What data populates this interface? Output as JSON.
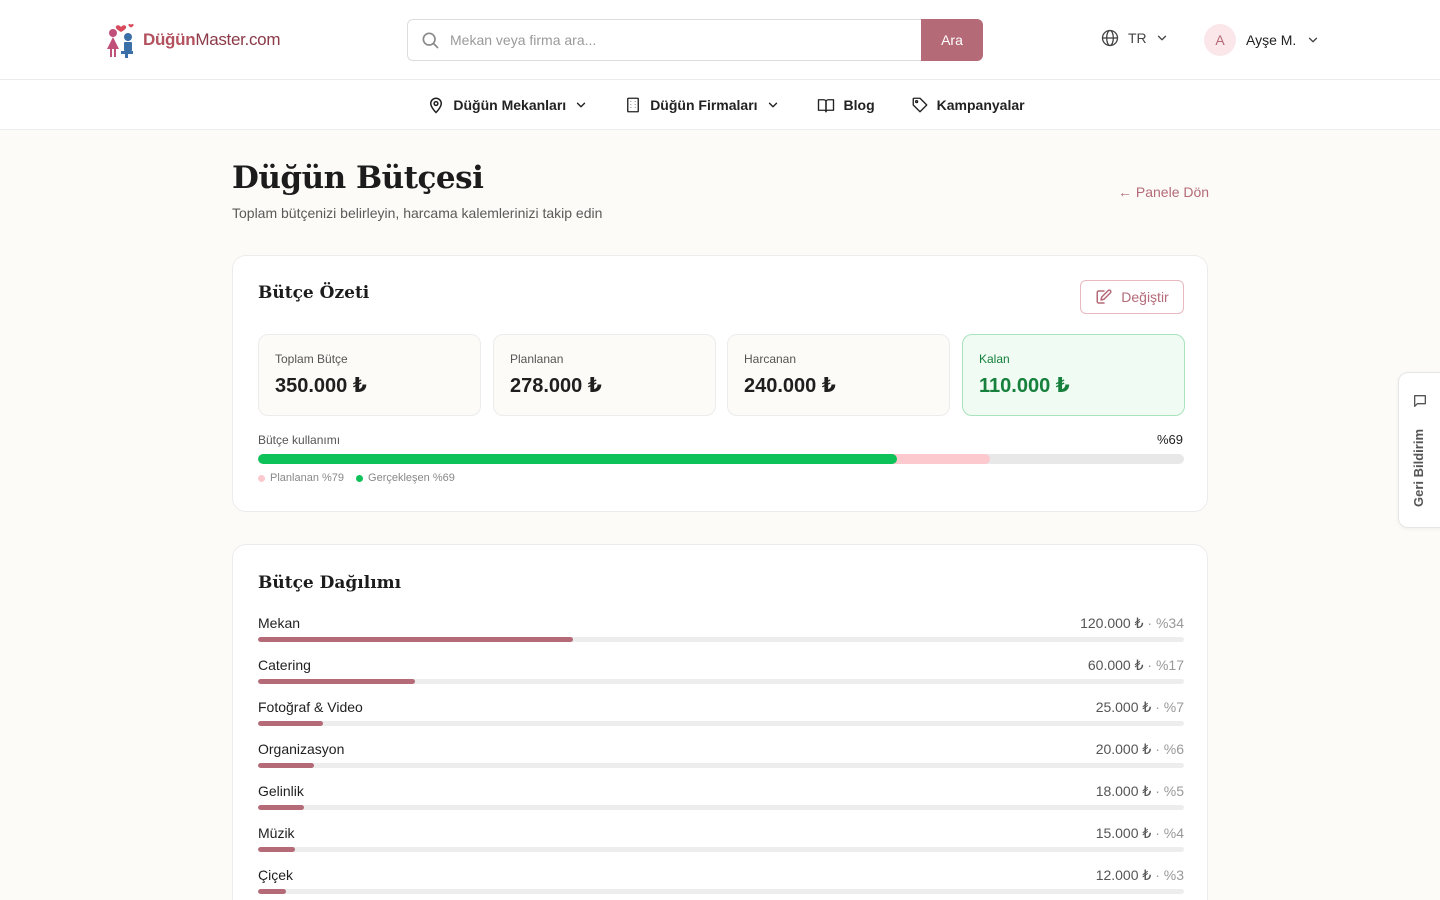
{
  "header": {
    "logo_text_main": "Düğün",
    "logo_text_sub": "Master.com",
    "search_placeholder": "Mekan veya firma ara...",
    "search_button": "Ara",
    "language": "TR",
    "user_initial": "A",
    "user_name": "Ayşe M."
  },
  "nav": {
    "items": [
      {
        "label": "Düğün Mekanları",
        "icon": "map-pin-icon",
        "has_dropdown": true
      },
      {
        "label": "Düğün Firmaları",
        "icon": "building-icon",
        "has_dropdown": true
      },
      {
        "label": "Blog",
        "icon": "book-open-icon",
        "has_dropdown": false
      },
      {
        "label": "Kampanyalar",
        "icon": "tag-icon",
        "has_dropdown": false
      }
    ]
  },
  "page": {
    "title": "Düğün Bütçesi",
    "subtitle": "Toplam bütçenizi belirleyin, harcama kalemlerinizi takip edin",
    "back_link": "← Panele Dön"
  },
  "summary": {
    "title": "Bütçe Özeti",
    "edit_button": "Değiştir",
    "stats": [
      {
        "label": "Toplam Bütçe",
        "value": "350.000 ₺"
      },
      {
        "label": "Planlanan",
        "value": "278.000 ₺"
      },
      {
        "label": "Harcanan",
        "value": "240.000 ₺"
      },
      {
        "label": "Kalan",
        "value": "110.000 ₺"
      }
    ],
    "usage_label": "Bütçe kullanımı",
    "usage_pct_text": "%69",
    "planned_pct": 79,
    "actual_pct": 69,
    "legend_planned": "Planlanan %79",
    "legend_actual": "Gerçekleşen %69",
    "colors": {
      "planned": "#fcc9ce",
      "actual": "#0ec25a",
      "remaining": "#16803c"
    }
  },
  "distribution": {
    "title": "Bütçe Dağılımı",
    "items": [
      {
        "name": "Mekan",
        "amount": "120.000 ₺",
        "pct_text": "%34",
        "pct": 34
      },
      {
        "name": "Catering",
        "amount": "60.000 ₺",
        "pct_text": "%17",
        "pct": 17
      },
      {
        "name": "Fotoğraf & Video",
        "amount": "25.000 ₺",
        "pct_text": "%7",
        "pct": 7
      },
      {
        "name": "Organizasyon",
        "amount": "20.000 ₺",
        "pct_text": "%6",
        "pct": 6
      },
      {
        "name": "Gelinlik",
        "amount": "18.000 ₺",
        "pct_text": "%5",
        "pct": 5
      },
      {
        "name": "Müzik",
        "amount": "15.000 ₺",
        "pct_text": "%4",
        "pct": 4
      },
      {
        "name": "Çiçek",
        "amount": "12.000 ₺",
        "pct_text": "%3",
        "pct": 3
      }
    ],
    "bar_color": "#b46a77"
  },
  "feedback": {
    "label": "Geri Bildirim"
  }
}
